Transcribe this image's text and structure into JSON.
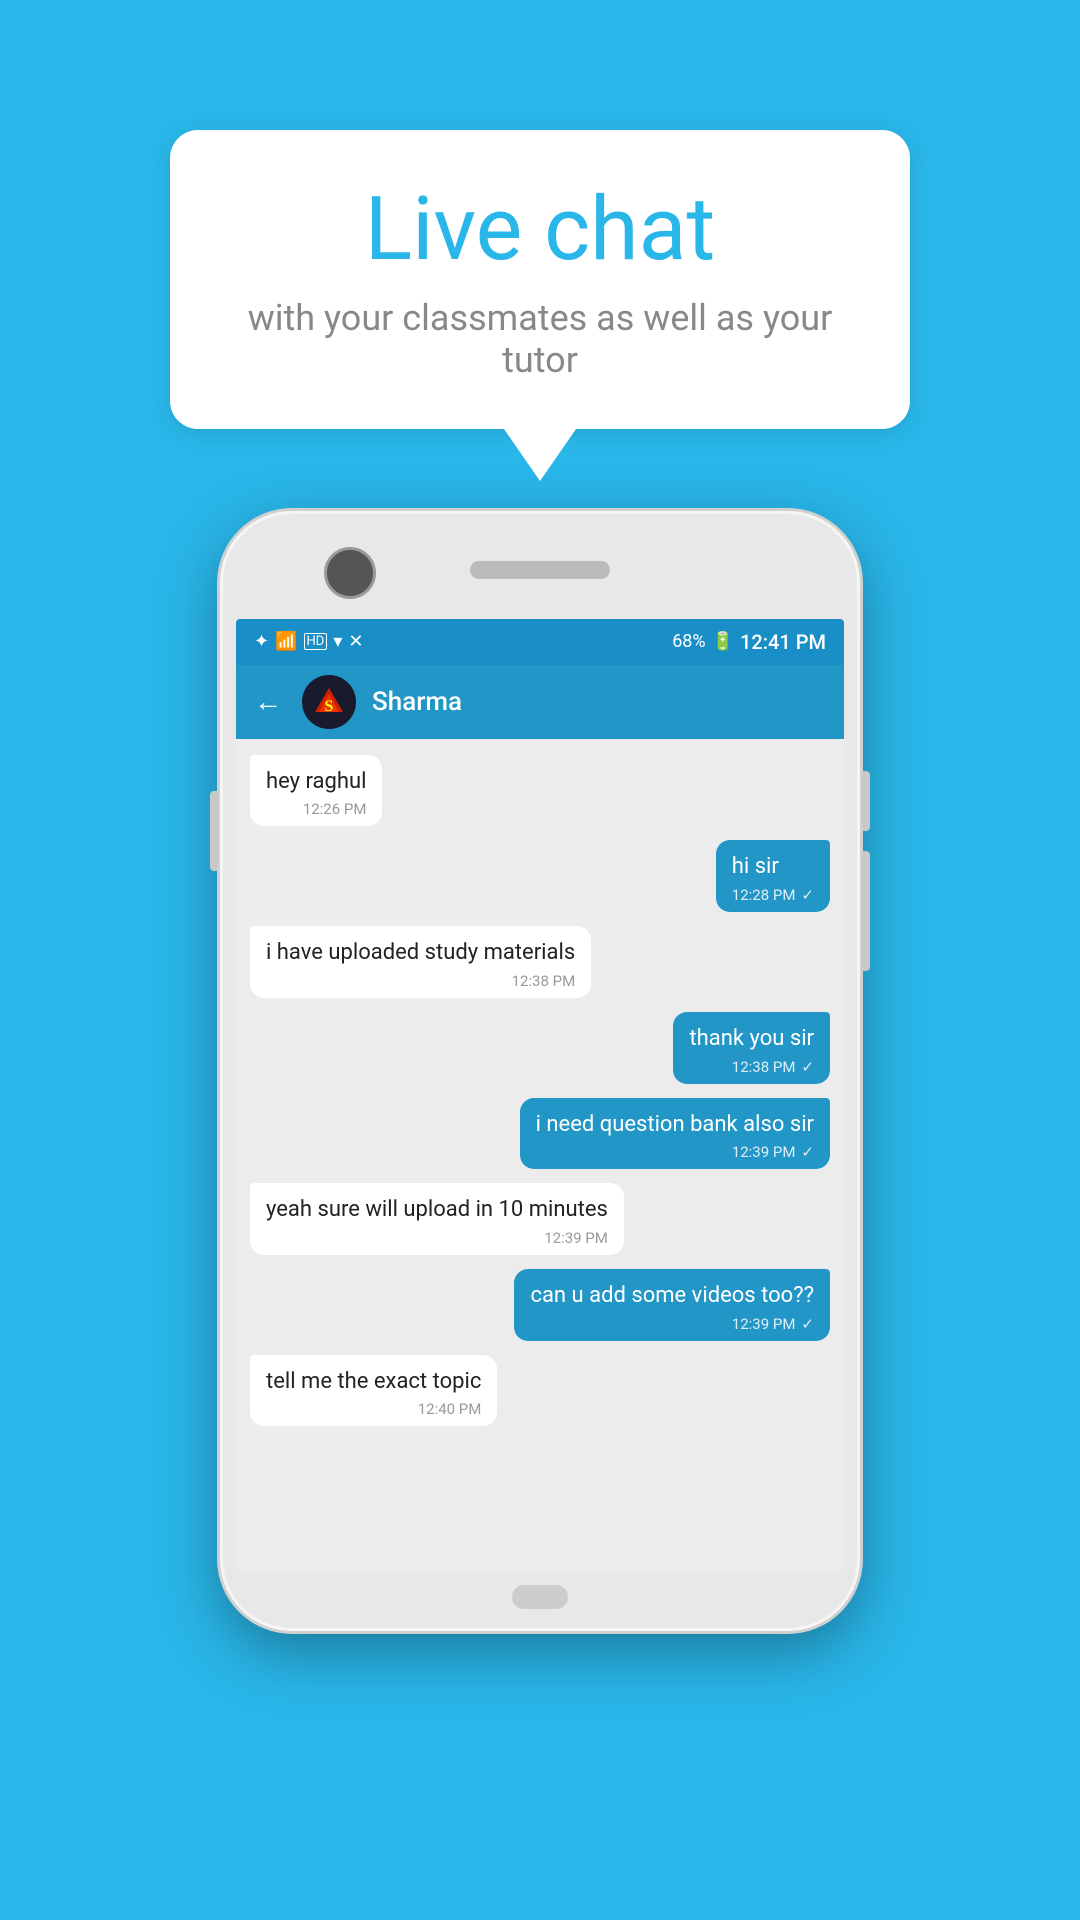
{
  "background_color": "#29b6e8",
  "bubble": {
    "title": "Live chat",
    "subtitle": "with your classmates as well as your tutor"
  },
  "phone": {
    "status_bar": {
      "time": "12:41 PM",
      "battery": "68%",
      "icons": "bluetooth signal wifi data"
    },
    "header": {
      "contact_name": "Sharma",
      "back_label": "←"
    },
    "messages": [
      {
        "id": 1,
        "type": "received",
        "text": "hey raghul",
        "time": "12:26 PM"
      },
      {
        "id": 2,
        "type": "sent",
        "text": "hi sir",
        "time": "12:28 PM"
      },
      {
        "id": 3,
        "type": "received",
        "text": "i have uploaded study materials",
        "time": "12:38 PM"
      },
      {
        "id": 4,
        "type": "sent",
        "text": "thank you sir",
        "time": "12:38 PM"
      },
      {
        "id": 5,
        "type": "sent",
        "text": "i need question bank also sir",
        "time": "12:39 PM"
      },
      {
        "id": 6,
        "type": "received",
        "text": "yeah sure will upload in 10 minutes",
        "time": "12:39 PM"
      },
      {
        "id": 7,
        "type": "sent",
        "text": "can u add some videos too??",
        "time": "12:39 PM"
      },
      {
        "id": 8,
        "type": "received",
        "text": "tell me the exact topic",
        "time": "12:40 PM"
      }
    ]
  }
}
